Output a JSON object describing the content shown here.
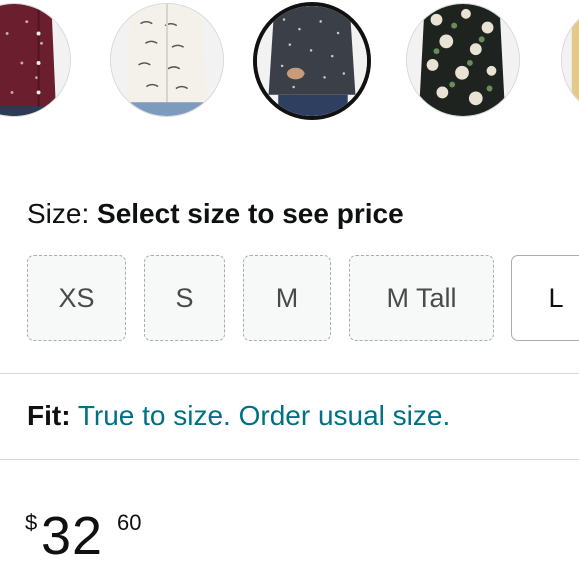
{
  "swatches": {
    "items": [
      {
        "name": "burgundy-print",
        "selected": false
      },
      {
        "name": "white-car-print",
        "selected": false
      },
      {
        "name": "charcoal-dot-print",
        "selected": true
      },
      {
        "name": "black-floral-print",
        "selected": false
      },
      {
        "name": "partial-next-swatch",
        "selected": false
      }
    ]
  },
  "size": {
    "label": "Size: ",
    "value": "Select size to see price",
    "options": [
      {
        "label": "XS",
        "available": false
      },
      {
        "label": "S",
        "available": false
      },
      {
        "label": "M",
        "available": false
      },
      {
        "label": "M Tall",
        "available": false
      },
      {
        "label": "L",
        "available": true
      }
    ]
  },
  "fit": {
    "label": "Fit:",
    "text": "True to size. Order usual size."
  },
  "price": {
    "symbol": "$",
    "whole": "32",
    "fraction": "60"
  },
  "colors": {
    "text": "#0f1111",
    "link": "#007185",
    "divider": "#d5d9d9",
    "selected_border": "#111111"
  }
}
